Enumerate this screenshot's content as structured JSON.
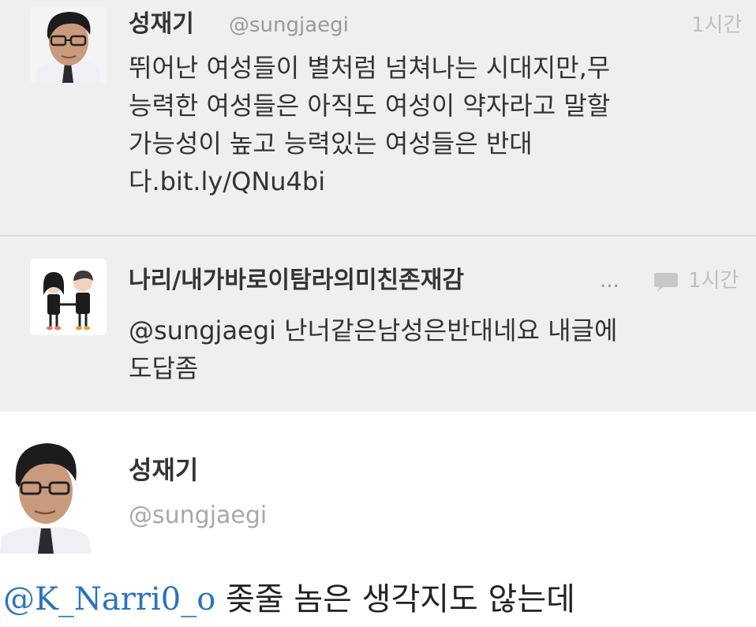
{
  "tweet1": {
    "name": "성재기",
    "handle": "@sungjaegi",
    "time": "1시간",
    "lines": [
      "뛰어난 여성들이 별처럼 넘쳐나는 시대지만,무",
      "능력한 여성들은 아직도 여성이 약자라고 말할",
      "가능성이 높고 능력있는 여성들은 반대",
      "다.bit.ly/QNu4bi"
    ]
  },
  "tweet2": {
    "name": "나리/내가바로이탐라의미친존재감",
    "ellipsis": "...",
    "time": "1시간",
    "lines": [
      "@sungjaegi 난너같은남성은반대네요 내글에",
      "도답좀"
    ]
  },
  "detail": {
    "name": "성재기",
    "handle": "@sungjaegi",
    "mention": "@K_Narri0_o",
    "text": "좆줄 놈은 생각지도 않는데"
  },
  "icons": {
    "reply": "speech-bubble-icon"
  },
  "colors": {
    "link": "#2a74ba",
    "card_bg": "#efefef"
  }
}
